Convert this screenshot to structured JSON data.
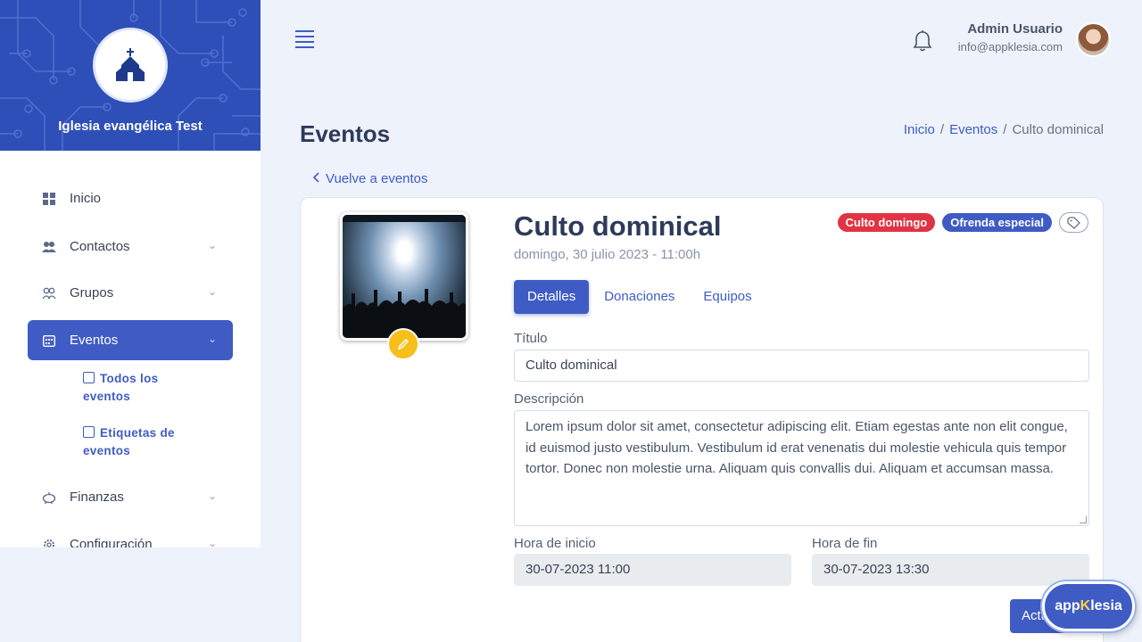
{
  "sidebar": {
    "church_name": "Iglesia evangélica Test",
    "items": [
      {
        "label": "Inicio",
        "icon": "grid-icon"
      },
      {
        "label": "Contactos",
        "icon": "users-icon"
      },
      {
        "label": "Grupos",
        "icon": "group-icon"
      },
      {
        "label": "Eventos",
        "icon": "calendar-icon"
      },
      {
        "label": "Finanzas",
        "icon": "piggy-bank-icon"
      },
      {
        "label": "Configuración",
        "icon": "gear-icon"
      }
    ],
    "sub_items": [
      {
        "label": "Todos los eventos",
        "icon": "calendar-icon"
      },
      {
        "label": "Etiquetas de eventos",
        "icon": "calendar-check-icon"
      }
    ]
  },
  "topbar": {
    "user_name": "Admin Usuario",
    "user_email": "info@appklesia.com"
  },
  "page": {
    "title": "Eventos",
    "breadcrumb": [
      "Inicio",
      "Eventos",
      "Culto dominical"
    ],
    "breadcrumb_sep": "/",
    "back_link": "Vuelve a eventos"
  },
  "event": {
    "title": "Culto dominical",
    "date": "domingo, 30 julio 2023 - 11:00h",
    "tags": [
      "Culto domingo",
      "Ofrenda especial"
    ],
    "tabs": [
      "Detalles",
      "Donaciones",
      "Equipos"
    ],
    "fields": {
      "title_label": "Título",
      "title_value": "Culto dominical",
      "description_label": "Descripción",
      "description_value": "Lorem ipsum dolor sit amet, consectetur adipiscing elit. Etiam egestas ante non elit congue, id euismod justo vestibulum. Vestibulum id erat venenatis dui molestie vehicula quis tempor tortor. Donec non molestie urna. Aliquam quis convallis dui. Aliquam et accumsan massa.",
      "start_label": "Hora de inicio",
      "start_value": "30-07-2023 11:00",
      "end_label": "Hora de fin",
      "end_value": "30-07-2023 13:30"
    },
    "update_button": "Actualizar"
  },
  "brand": {
    "part1": "app",
    "part2": "K",
    "part3": "lesia"
  },
  "colors": {
    "primary": "#3f5cc4",
    "danger": "#e03444",
    "warning": "#f6bf1a"
  }
}
